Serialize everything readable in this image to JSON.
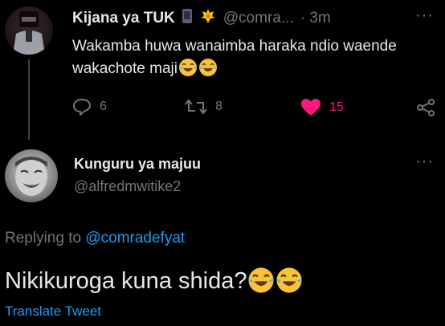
{
  "original_tweet": {
    "name": "Kijana ya TUK",
    "handle": "@comra...",
    "time": "· 3m",
    "text": "Wakamba huwa wanaimba haraka ndio waende wakachote maji",
    "actions": {
      "replies": "6",
      "retweets": "8",
      "likes": "15"
    },
    "icons": [
      "phone-icon",
      "crown-emblem-icon",
      "reply-icon",
      "retweet-icon",
      "heart-icon",
      "share-icon",
      "tears-of-joy-emoji"
    ]
  },
  "reply_tweet": {
    "name": "Kunguru ya majuu",
    "handle": "@alfredmwitike2",
    "replying_prefix": "Replying to",
    "replying_to": "@comradefyat",
    "text": "Nikikuroga kuna shida?",
    "translate_label": "Translate Tweet"
  },
  "colors": {
    "background": "#000000",
    "primary_text": "#e7e9ea",
    "secondary_text": "#71767b",
    "link": "#1d9bf0",
    "like": "#f91880"
  },
  "more_label": "···"
}
